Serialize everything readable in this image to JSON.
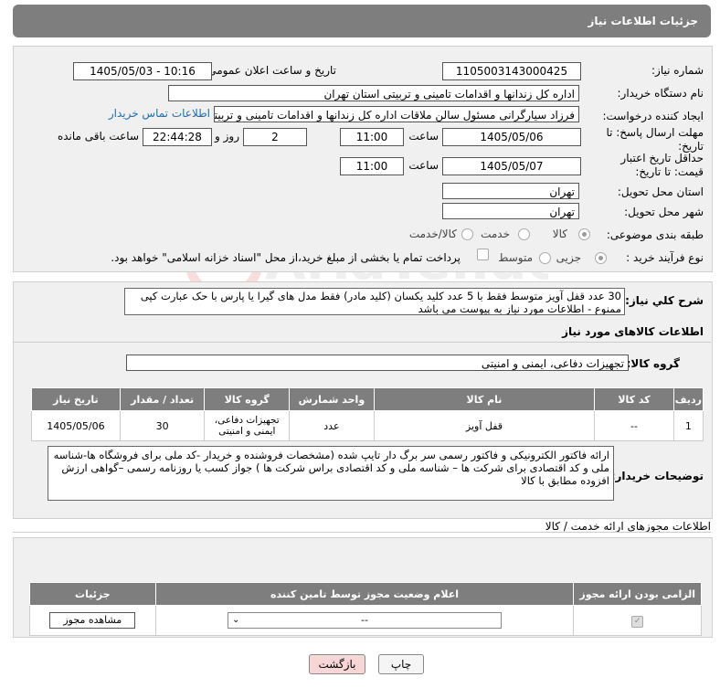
{
  "header": {
    "title": "جزئیات اطلاعات نیاز"
  },
  "form": {
    "need_number_label": "شماره نیاز:",
    "need_number": "1105003143000425",
    "announce_label": "تاریخ و ساعت اعلان عمومی:",
    "announce_value": "1405/05/03 - 10:16",
    "buyer_org_label": "نام دستگاه خریدار:",
    "buyer_org": "اداره کل زندانها و اقدامات تامینی و تربیتی استان تهران",
    "creator_label": "ایجاد کننده درخواست:",
    "creator": "فرزاد سیارگرانی مسئول سالن ملاقات  اداره کل زندانها و اقدامات تامینی و تربیتی",
    "contact_link": "اطلاعات تماس خریدار",
    "reply_deadline_label": "مهلت ارسال پاسخ: تا تاریخ:",
    "reply_date": "1405/05/06",
    "time_label": "ساعت",
    "reply_time": "11:00",
    "days": "2",
    "days_label": "روز و",
    "remaining": "22:44:28",
    "remaining_label": "ساعت باقی مانده",
    "price_validity_label": "حداقل تاریخ اعتبار قیمت: تا تاریخ:",
    "validity_date": "1405/05/07",
    "validity_time": "11:00",
    "province_label": "استان محل تحویل:",
    "province": "تهران",
    "city_label": "شهر محل تحویل:",
    "city": "تهران",
    "category_label": "طبقه بندی موضوعی:",
    "category_options": [
      "کالا",
      "خدمت",
      "کالا/خدمت"
    ],
    "process_label": "نوع فرآیند خرید :",
    "process_options": [
      "جزیی",
      "متوسط"
    ],
    "payment_note": "پرداخت تمام یا بخشی از مبلغ خرید،از محل \"اسناد خزانه اسلامی\" خواهد بود."
  },
  "description": {
    "label": "شرح کلي نياز:",
    "text": "30 عدد قفل آویز متوسط فقط با 5 عدد کلید یکسان (کلید مادر) فقط مدل های گیرا یا پارس با حک عبارت کپی ممنوع - اطلاعات مورد نیاز به پیوست می باشد"
  },
  "goods": {
    "section_title": "اطلاعات کالاهای مورد نياز",
    "group_label": "گروه کالا:",
    "group_value": "تجهیزات دفاعی، ایمنی و امنیتی",
    "columns": [
      "ردیف",
      "کد کالا",
      "نام کالا",
      "واحد شمارش",
      "گروه کالا",
      "تعداد / مقدار",
      "تاریخ نیاز"
    ],
    "rows": [
      {
        "idx": "1",
        "code": "--",
        "name": "قفل آویز",
        "unit": "عدد",
        "group": "تجهیزات دفاعی، ایمنی و امنیتی",
        "qty": "30",
        "date": "1405/05/06"
      }
    ]
  },
  "buyer_notes": {
    "label": "توضیحات خریدار:",
    "text": "ارائه فاکتور الکترونیکی و فاکتور رسمی سر برگ دار تایپ شده (مشخصات فروشنده و خریدار -کد ملی برای فروشگاه ها-شناسه ملی و کد اقتصادی برای شرکت ها – شناسه ملی و کد اقتصادی براس شرکت ها ) جواز کسب یا روزنامه رسمی –گواهی ارزش افزوده مطابق با کالا"
  },
  "licenses": {
    "section_title": "اطلاعات مجوزهای ارائه خدمت / کالا",
    "columns": [
      "الزامی بودن ارائه مجوز",
      "اعلام وضعیت مجوز توسط تامین کننده",
      "جزئیات"
    ],
    "select_value": "--",
    "view_button": "مشاهده مجوز"
  },
  "buttons": {
    "print": "چاپ",
    "back": "بازگشت"
  },
  "colors": {
    "header_bg": "#7e7e7e",
    "panel_bg": "#f0f0f0",
    "link": "#1a6fb3",
    "back_btn": "#f9d6d6"
  }
}
